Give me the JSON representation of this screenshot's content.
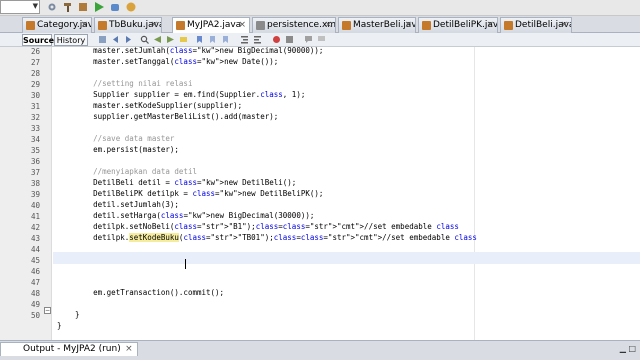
{
  "tabs": [
    {
      "label": "Category.java",
      "color": "#c47a2a",
      "active": false
    },
    {
      "label": "TbBuku.java",
      "color": "#c47a2a",
      "active": false
    },
    {
      "label": "MyJPA2.java",
      "color": "#c47a2a",
      "active": true
    },
    {
      "label": "persistence.xml",
      "color": "#8a8a8a",
      "active": false
    },
    {
      "label": "MasterBeli.java",
      "color": "#c47a2a",
      "active": false
    },
    {
      "label": "DetilBeliPK.java",
      "color": "#c47a2a",
      "active": false
    },
    {
      "label": "DetilBeli.java",
      "color": "#c47a2a",
      "active": false
    }
  ],
  "editor_toolbar": {
    "source_label": "Source",
    "history_label": "History"
  },
  "gutter_numbers": [
    "26",
    "27",
    "28",
    "29",
    "30",
    "31",
    "32",
    "33",
    "34",
    "35",
    "36",
    "37",
    "38",
    "39",
    "40",
    "41",
    "42",
    "43",
    "44",
    "45",
    "46",
    "47",
    "48",
    "49",
    "50"
  ],
  "code": {
    "l26": "        master.setJumlah(new BigDecimal(90000));",
    "l27": "        master.setTanggal(new Date());",
    "l29": "        //setting nilai relasi",
    "l30": "        Supplier supplier = em.find(Supplier.class, 1);",
    "l31": "        master.setKodeSupplier(supplier);",
    "l32": "        supplier.getMasterBeliList().add(master);",
    "l34": "        //save data master",
    "l35": "        em.persist(master);",
    "l37": "        //menyiapkan data detil",
    "l38": "        DetilBeli detil = new DetilBeli();",
    "l39": "        DetilBeliPK detilpk = new DetilBeliPK();",
    "l40": "        detil.setJumlah(3);",
    "l41": "        detil.setHarga(new BigDecimal(30000));",
    "l42": "        detilpk.setNoBeli(\"B1\");//set embedable class",
    "l43": "        detilpk.setKodeBuku(\"TB01\");//set embedable class",
    "l47": "        em.getTransaction().commit();",
    "l49": "    }",
    "l50": "}"
  },
  "output": {
    "tab_label": "Output - MyJPA2 (run)"
  },
  "colors": {
    "keyword": "#0000e6",
    "string": "#ce7b00",
    "comment": "#969696",
    "highlight": "#f5ec9e"
  },
  "icons": [
    "run-icon",
    "debug-icon",
    "back-icon",
    "forward-icon",
    "search-icon",
    "bookmark-icon",
    "comment-icon",
    "stop-icon"
  ]
}
